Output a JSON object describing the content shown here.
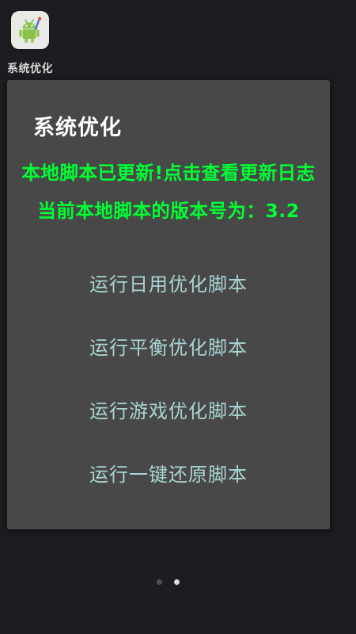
{
  "launcher": {
    "app_label": "系统优化",
    "icon": "android-robot-icon"
  },
  "dialog": {
    "title": "系统优化",
    "notice_line1": "本地脚本已更新!点击查看更新日志",
    "notice_line2": "当前本地脚本的版本号为：3.2",
    "notice_color": "#00ff33",
    "items": [
      {
        "label": "运行日用优化脚本"
      },
      {
        "label": "运行平衡优化脚本"
      },
      {
        "label": "运行游戏优化脚本"
      },
      {
        "label": "运行一键还原脚本"
      }
    ]
  },
  "page_indicator": {
    "total": 2,
    "active": 2
  }
}
